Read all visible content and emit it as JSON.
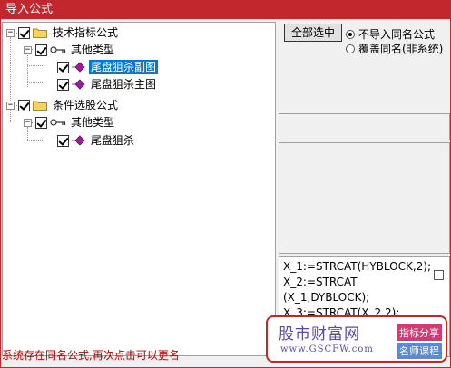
{
  "window": {
    "title": "导入公式"
  },
  "tree": {
    "nodes": [
      {
        "label": "技术指标公式",
        "type": "folder",
        "level": 0,
        "checked": true,
        "expanded": true
      },
      {
        "label": "其他类型",
        "type": "key",
        "level": 1,
        "checked": true,
        "expanded": true
      },
      {
        "label": "尾盘狙杀副图",
        "type": "formula",
        "level": 2,
        "checked": true,
        "selected": true
      },
      {
        "label": "尾盘狙杀主图",
        "type": "formula",
        "level": 2,
        "checked": true,
        "selected": false
      },
      {
        "label": "条件选股公式",
        "type": "folder",
        "level": 0,
        "checked": true,
        "expanded": true
      },
      {
        "label": "其他类型",
        "type": "key",
        "level": 1,
        "checked": true,
        "expanded": true
      },
      {
        "label": "尾盘狙杀",
        "type": "formula",
        "level": 2,
        "checked": true,
        "selected": false
      }
    ]
  },
  "options": {
    "select_all_label": "全部选中",
    "radio_no_import": "不导入同名公式",
    "radio_overwrite": "覆盖同名(非系统)",
    "selected_option": "不导入同名公式"
  },
  "code_preview": {
    "lines": [
      "X_1:=STRCAT(HYBLOCK,2);",
      "X_2:=STRCAT",
      "(X_1,DYBLOCK);",
      "X_3:=STRCAT(X_2,2);"
    ]
  },
  "status": {
    "message": "系统存在同名公式,再次点击可以更名"
  },
  "watermark": {
    "title": "股市财富网",
    "url": "www.GSCFW.com",
    "tag1": "指标分享",
    "tag2": "名师课程"
  },
  "colors": {
    "titlebar": "#c1272d",
    "selection": "#0078d7",
    "status_text": "#c00000",
    "watermark_purple": "#5b4aa8"
  }
}
